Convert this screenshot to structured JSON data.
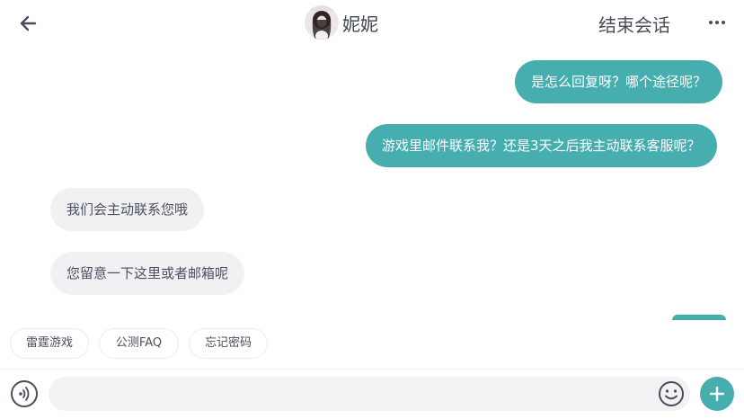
{
  "header": {
    "title": "妮妮",
    "end_chat_label": "结束会话",
    "back_icon": "arrow-left-icon",
    "more_icon": "more-horizontal-icon"
  },
  "messages": [
    {
      "direction": "out",
      "text": "是怎么回复呀？哪个途径呢？"
    },
    {
      "direction": "out",
      "text": "游戏里邮件联系我？还是3天之后我主动联系客服呢？"
    },
    {
      "direction": "in",
      "text": "我们会主动联系您哦"
    },
    {
      "direction": "in",
      "text": "您留意一下这里或者邮箱呢"
    }
  ],
  "quick_replies": [
    {
      "label": "雷霆游戏"
    },
    {
      "label": "公测FAQ"
    },
    {
      "label": "忘记密码"
    }
  ],
  "composer": {
    "placeholder": "",
    "voice_icon": "voice-icon",
    "emoji_icon": "emoji-icon",
    "add_icon": "plus-icon"
  },
  "colors": {
    "accent": "#47aeb0",
    "incoming_bubble": "#f1f1f3",
    "text": "#4a4e5c"
  }
}
